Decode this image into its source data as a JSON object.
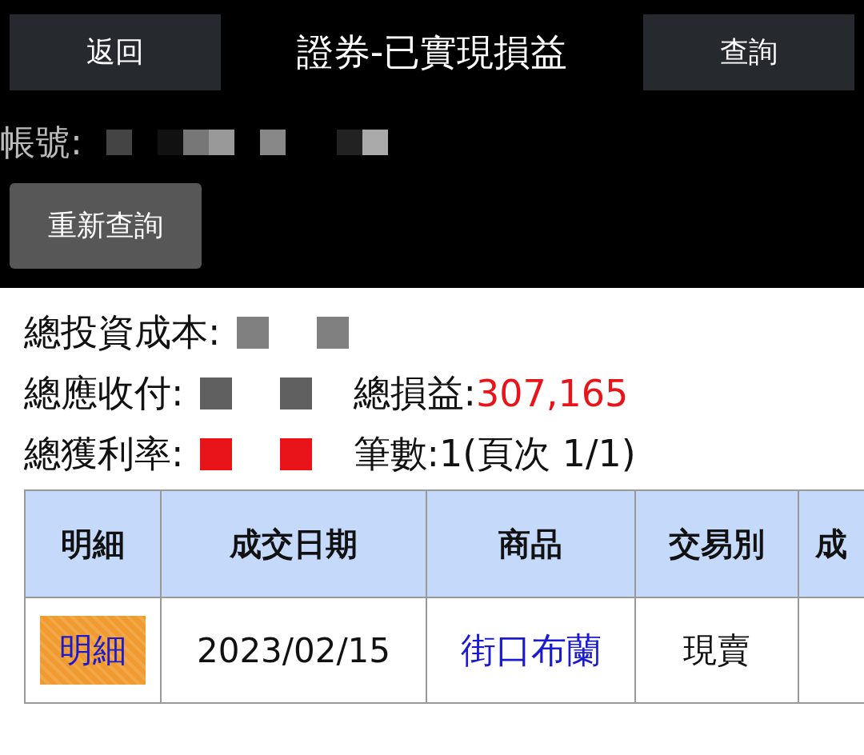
{
  "header": {
    "back_button": "返回",
    "title": "證券-已實現損益",
    "query_button": "查詢"
  },
  "account": {
    "label": "帳號:"
  },
  "requery_button": "重新查詢",
  "summary_lines": [
    [
      {
        "kind": "label",
        "text": "總投資成本:"
      },
      {
        "kind": "redacted",
        "color": "#808080"
      }
    ],
    [
      {
        "kind": "label",
        "text": "總應收付:"
      },
      {
        "kind": "redacted",
        "color": "#606060"
      },
      {
        "kind": "label",
        "text": "總損益:"
      },
      {
        "kind": "value",
        "text": "307,165",
        "color": "#e8141a"
      }
    ],
    [
      {
        "kind": "label",
        "text": "總獲利率:"
      },
      {
        "kind": "redacted",
        "color": "#e8141a"
      },
      {
        "kind": "label",
        "text": "筆數:1(頁次 1/1)"
      }
    ]
  ],
  "table": {
    "columns": [
      "明細",
      "成交日期",
      "商品",
      "交易別",
      "成"
    ],
    "rows": [
      {
        "cells": [
          {
            "kind": "button",
            "text": "明細"
          },
          {
            "kind": "text",
            "text": "2023/02/15"
          },
          {
            "kind": "link",
            "text": "街口布蘭"
          },
          {
            "kind": "text",
            "text": "現賣"
          }
        ]
      }
    ]
  }
}
